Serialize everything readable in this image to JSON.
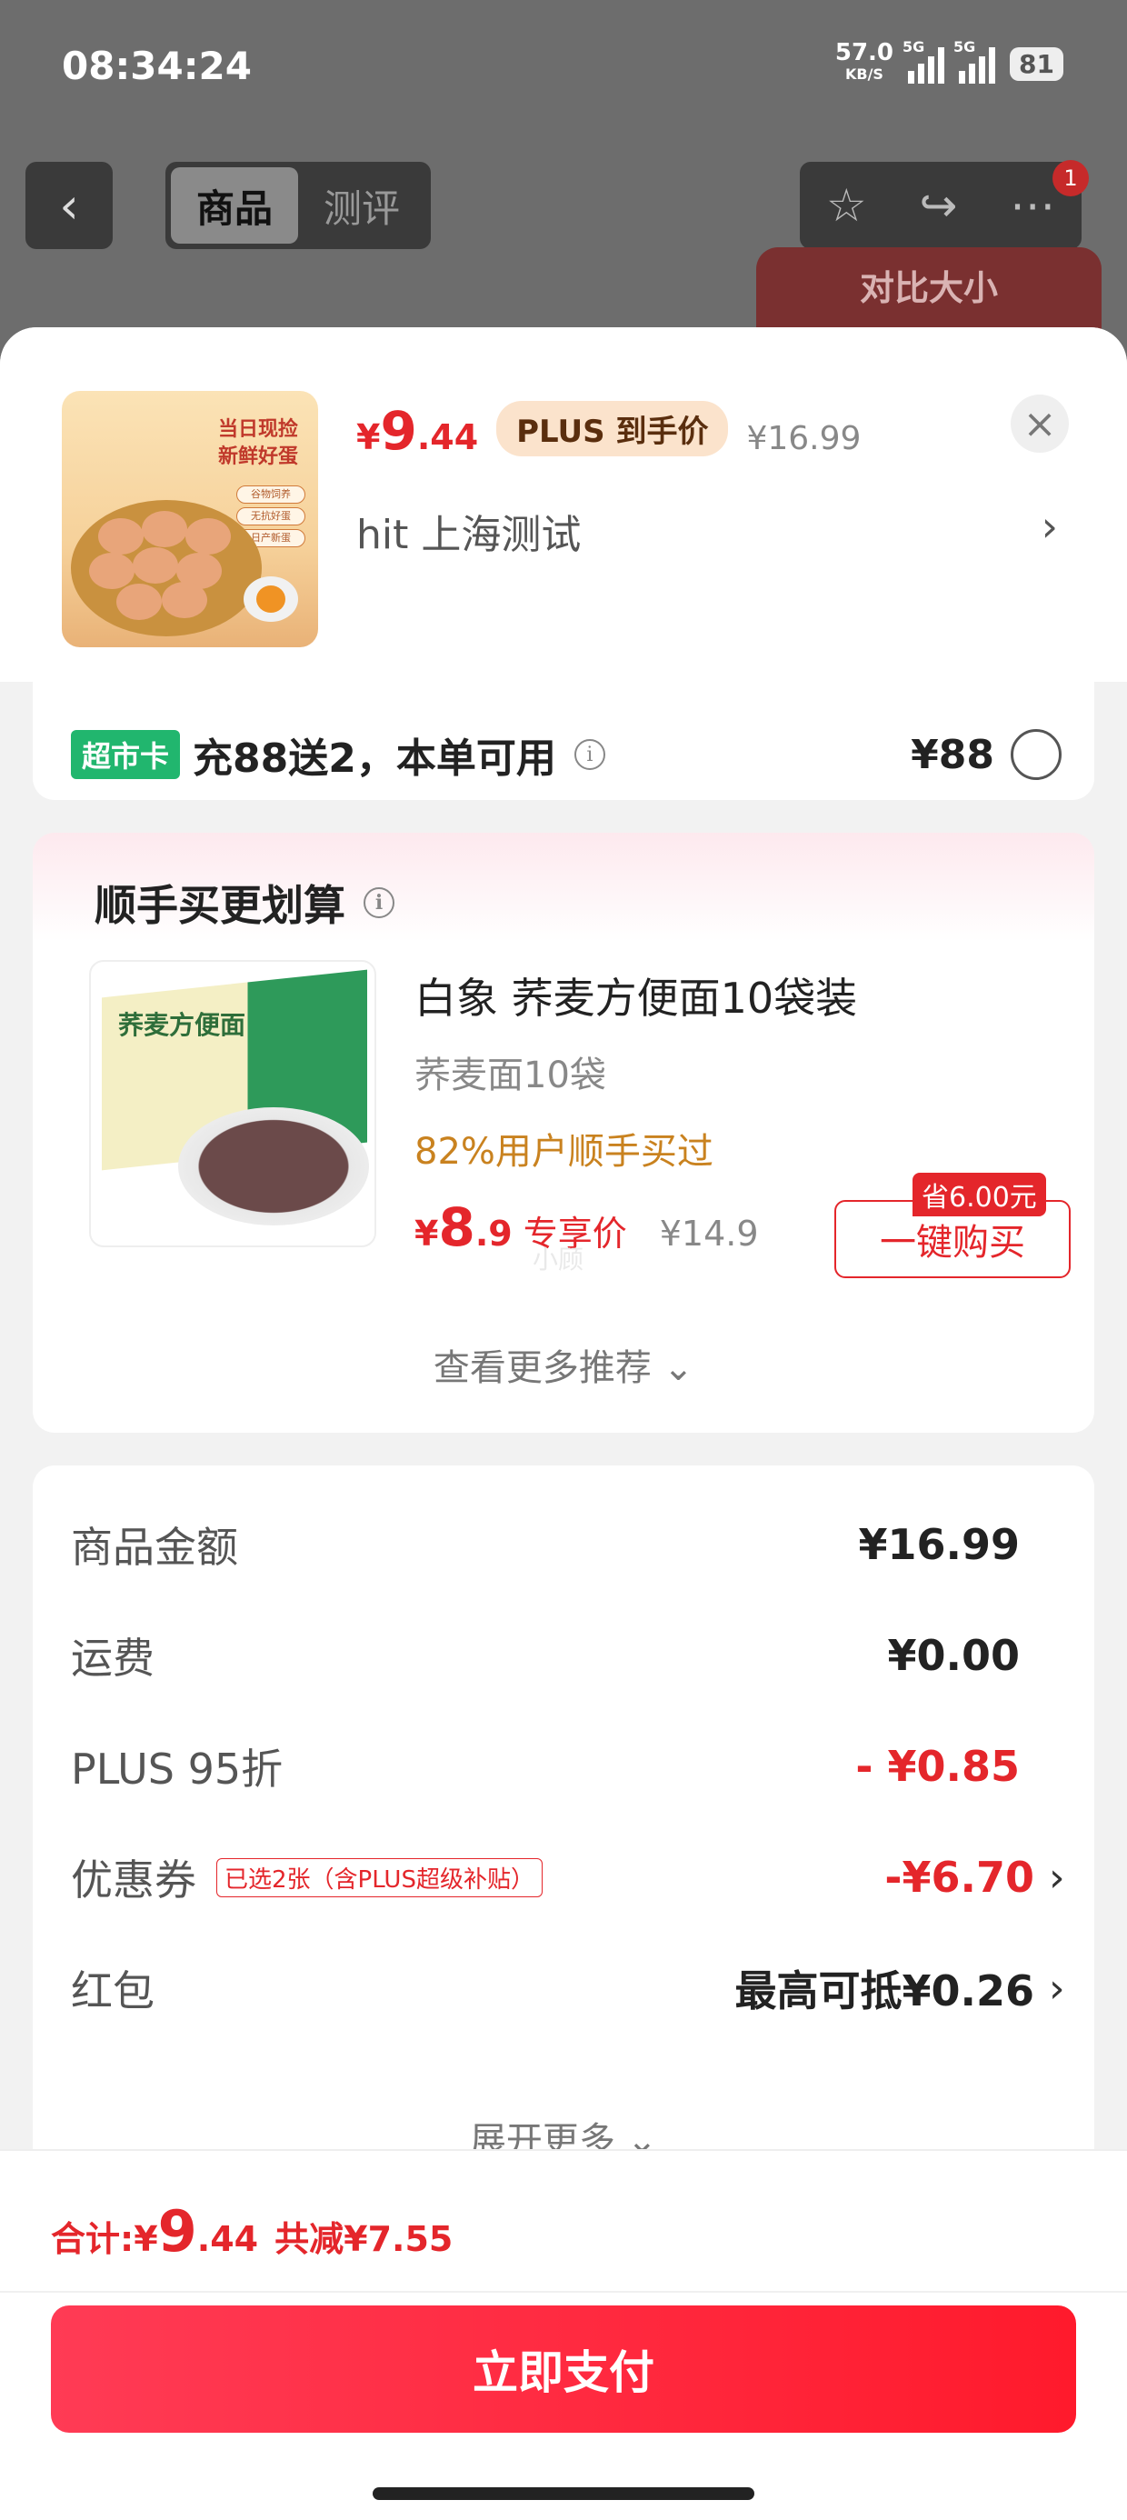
{
  "status_bar": {
    "time": "08:34:24",
    "net_speed": "57.0",
    "net_unit": "KB/S",
    "signal1_tag": "5G",
    "signal2_tag": "5G",
    "battery": "81"
  },
  "nav": {
    "back_icon": "‹",
    "tabs": [
      "商品",
      "测评"
    ],
    "icons": [
      "star-icon",
      "share-icon",
      "more-icon"
    ],
    "notification_count": "1",
    "compare_label": "对比大小"
  },
  "sheet": {
    "product": {
      "image_tagline_1": "当日现捡",
      "image_tagline_2": "新鲜好蛋",
      "image_pills": [
        "谷物饲养",
        "无抗好蛋",
        "日产新蛋"
      ],
      "price_currency": "¥",
      "price_int": "9",
      "price_dec": ".44",
      "plus_label": "PLUS 到手价",
      "price_original": "¥16.99",
      "address": "hit  上海测试",
      "close_icon": "×",
      "address_chevron": "›"
    },
    "supermarket_card": {
      "tag": "超市卡",
      "text": "充88送2，本单可用",
      "price": "¥88"
    },
    "recommend": {
      "title": "顺手买更划算",
      "item": {
        "image_label": "荞麦方便面",
        "name": "白象 荞麦方便面10袋装",
        "spec": "荞麦面10袋",
        "buy_rate": "82%用户顺手买过",
        "price_currency": "¥",
        "price_int": "8",
        "price_dec": ".9",
        "special_label": "专享价",
        "price_original": "¥14.9",
        "save_tag": "省6.00元",
        "buy_button": "一键购买",
        "watermark": "小顾"
      },
      "more_label": "查看更多推荐 ⌄"
    },
    "summary": {
      "rows": [
        {
          "label": "商品金额",
          "value": "¥16.99"
        },
        {
          "label": "运费",
          "value": "¥0.00"
        },
        {
          "label": "PLUS 95折",
          "value": "- ¥0.85"
        },
        {
          "label": "优惠券",
          "tag": "已选2张（含PLUS超级补贴）",
          "value": "-¥6.70"
        },
        {
          "label": "红包",
          "value": "最高可抵¥0.26"
        }
      ],
      "expand_label": "展开更多 ⌄"
    }
  },
  "bottom": {
    "total_label": "合计: ",
    "total_currency": "¥",
    "total_int": "9",
    "total_dec": ".44",
    "saved": "共减¥7.55",
    "pay_button": "立即支付"
  },
  "colors": {
    "accent_red": "#e4262b",
    "tag_green": "#21b66e",
    "plus_bg": "#fbe3cc",
    "buy_rate_orange": "#c9821f"
  }
}
